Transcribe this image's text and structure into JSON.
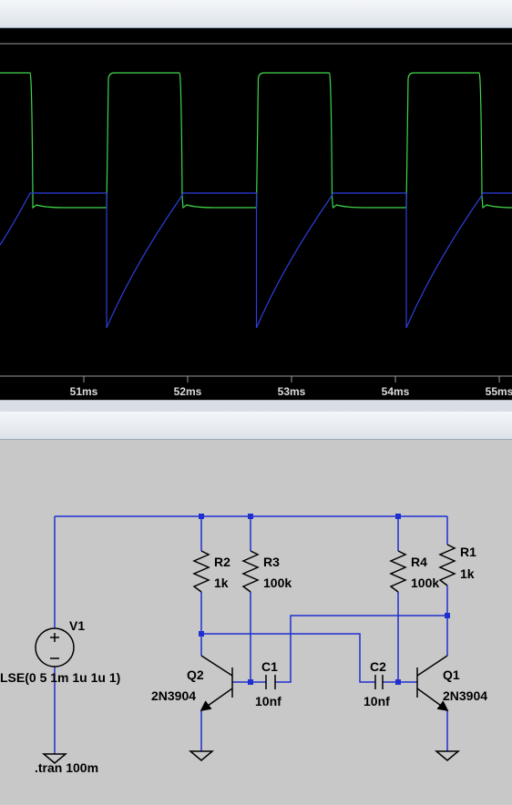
{
  "colors": {
    "plot_bg": "#000000",
    "trace_green": "#3fd64a",
    "trace_blue": "#2e3fdc",
    "wire_blue": "#1f2fd0",
    "schematic_bg": "#c8c8c8",
    "tick_text": "#dcdcdc"
  },
  "waveform": {
    "x_axis_ticks": [
      "51ms",
      "52ms",
      "53ms",
      "54ms",
      "55ms"
    ]
  },
  "schematic": {
    "components": {
      "R2": {
        "name": "R2",
        "value": "1k"
      },
      "R3": {
        "name": "R3",
        "value": "100k"
      },
      "R4": {
        "name": "R4",
        "value": "100k"
      },
      "R1": {
        "name": "R1",
        "value": "1k"
      },
      "V1": {
        "name": "V1",
        "value": "LSE(0 5 1m 1u 1u 1)"
      },
      "Q2": {
        "name": "Q2",
        "model": "2N3904"
      },
      "Q1": {
        "name": "Q1",
        "model": "2N3904"
      },
      "C1": {
        "name": "C1",
        "value": "10nf"
      },
      "C2": {
        "name": "C2",
        "value": "10nf"
      }
    },
    "directive": ".tran 100m",
    "icons": [
      "voltage-source-icon",
      "resistor-icon",
      "capacitor-icon",
      "npn-transistor-icon",
      "ground-icon"
    ]
  }
}
